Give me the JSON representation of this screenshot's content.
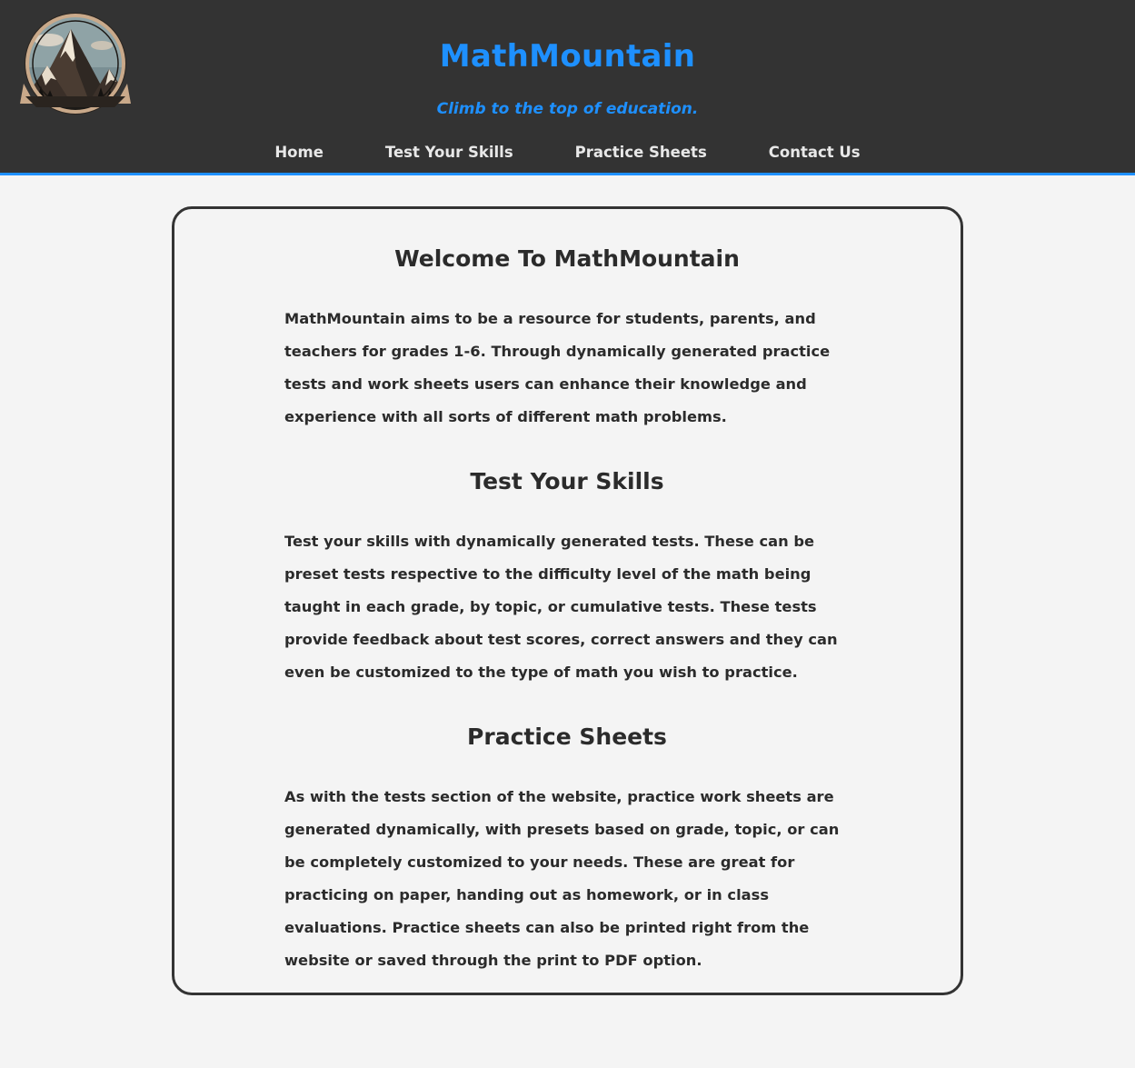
{
  "header": {
    "title": "MathMountain",
    "tagline": "Climb to the top of education.",
    "logo_icon": "mountain-logo-icon",
    "accent_color": "#1e90ff",
    "background_color": "#333333"
  },
  "nav": {
    "items": [
      {
        "label": "Home"
      },
      {
        "label": "Test Your Skills"
      },
      {
        "label": "Practice Sheets"
      },
      {
        "label": "Contact Us"
      }
    ]
  },
  "main": {
    "sections": [
      {
        "heading": "Welcome To MathMountain",
        "body": "MathMountain aims to be a resource for students, parents, and teachers for grades 1-6. Through dynamically generated practice tests and work sheets users can enhance their knowledge and experience with all sorts of different math problems."
      },
      {
        "heading": "Test Your Skills",
        "body": "Test your skills with dynamically generated tests. These can be preset tests respective to the difficulty level of the math being taught in each grade, by topic, or cumulative tests. These tests provide feedback about test scores, correct answers and they can even be customized to the type of math you wish to practice."
      },
      {
        "heading": "Practice Sheets",
        "body": "As with the tests section of the website, practice work sheets are generated dynamically, with presets based on grade, topic, or can be completely customized to your needs. These are great for practicing on paper, handing out as homework, or in class evaluations. Practice sheets can also be printed right from the website or saved through the print to PDF option."
      }
    ]
  }
}
